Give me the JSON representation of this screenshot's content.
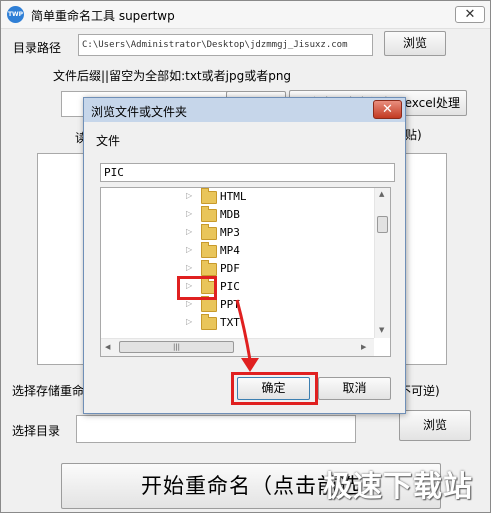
{
  "app": {
    "logo_text": "TWP",
    "title": "简单重命名工具 supertwp",
    "close_symbol": "✕"
  },
  "main": {
    "dir_label": "目录路径",
    "dir_value": "C:\\Users\\Administrator\\Desktop\\jdzmmgj_Jisuxz.com",
    "browse_label": "浏览",
    "ext_label": "文件后缀||留空为全部如:txt或者jpg或者png",
    "ext_value": "",
    "excel_button_label": "点击导出文件名到excel处理",
    "read_label": "读",
    "paste_label": "贴)",
    "save_label": "选择存储重命",
    "irreversible_label": "不可逆)",
    "target_dir_label": "选择目录",
    "target_dir_value": "",
    "browse_bottom_label": "浏览",
    "start_button_label": "开始重命名（点击前选",
    "watermark": "极速下载站"
  },
  "dialog": {
    "title": "浏览文件或文件夹",
    "close_symbol": "✕",
    "file_label": "文件",
    "path_value": "PIC",
    "folders": [
      "HTML",
      "MDB",
      "MP3",
      "MP4",
      "PDF",
      "PIC",
      "PPT",
      "TXT"
    ],
    "selected_folder": "PIC",
    "ok_label": "确定",
    "cancel_label": "取消"
  },
  "colors": {
    "highlight": "#e02020",
    "folder": "#e9c55a",
    "dialog_title_bg": "#c6d6ea"
  }
}
